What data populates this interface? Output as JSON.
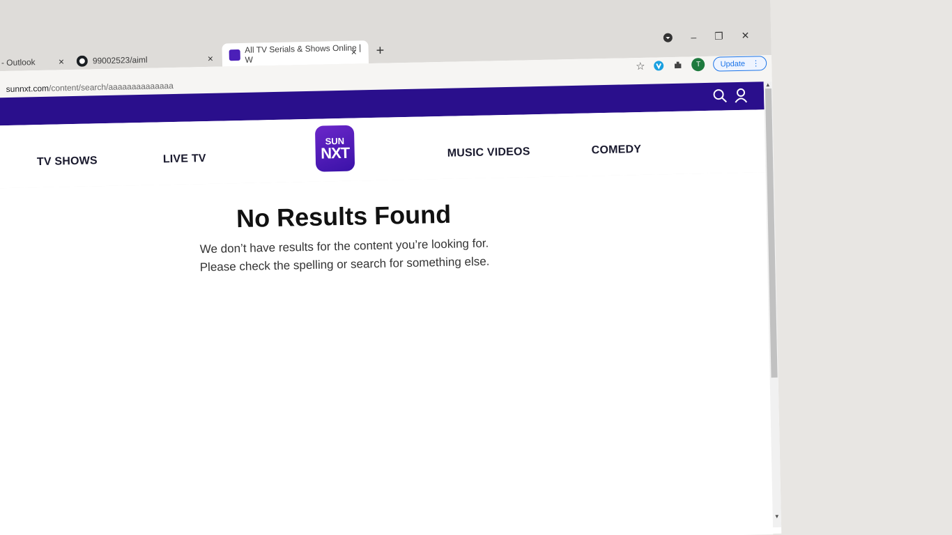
{
  "tabs": [
    {
      "title": "- Outlook",
      "close": "×",
      "favicon": "outlook-icon"
    },
    {
      "title": "99002523/aiml",
      "close": "×",
      "favicon": "github-icon"
    },
    {
      "title": "All TV Serials & Shows Online | W",
      "close": "×",
      "favicon": "sunnxt-icon",
      "active": true
    }
  ],
  "new_tab": "+",
  "window_controls": {
    "minimize": "–",
    "restore": "❐",
    "close": "✕"
  },
  "address_bar": {
    "domain": "sunnxt.com",
    "path": "/content/search/aaaaaaaaaaaaaa"
  },
  "toolbar": {
    "star": "☆",
    "avatar_letter": "T",
    "update_label": "Update",
    "menu": "⋮"
  },
  "site": {
    "nav": {
      "tv_shows": "TV SHOWS",
      "live_tv": "LIVE TV",
      "music_videos": "MUSIC VIDEOS",
      "comedy": "COMEDY"
    },
    "logo": {
      "line1": "SUN",
      "line2": "NXT"
    },
    "brand_color": "#2a0f8c"
  },
  "results": {
    "title": "No Results Found",
    "message_line1": "We don’t have results for the content you’re looking for.",
    "message_line2": "Please check the spelling or search for something else."
  }
}
